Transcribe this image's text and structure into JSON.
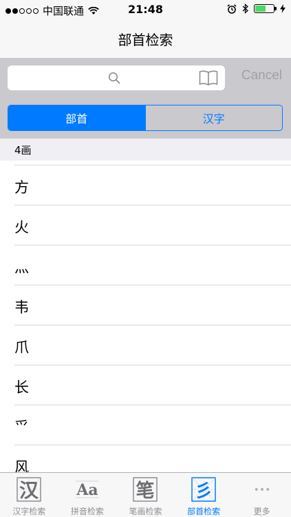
{
  "status_bar": {
    "carrier": "中国联通",
    "time": "21:48"
  },
  "nav": {
    "title": "部首检索"
  },
  "search": {
    "placeholder": "",
    "cancel_label": "Cancel"
  },
  "segments": [
    {
      "label": "部首",
      "selected": true
    },
    {
      "label": "汉字",
      "selected": false
    }
  ],
  "section": {
    "header": "4画"
  },
  "list_items": [
    "方",
    "火",
    "灬",
    "韦",
    "爪",
    "长",
    "爫",
    "风"
  ],
  "tabs": [
    {
      "label": "汉字检索",
      "icon_char": "汉",
      "active": false
    },
    {
      "label": "拼音检索",
      "icon_char": "Aa",
      "active": false
    },
    {
      "label": "笔画检索",
      "icon_char": "笔",
      "active": false
    },
    {
      "label": "部首检索",
      "icon_char": "彡",
      "active": true
    },
    {
      "label": "更多",
      "icon_char": "•••",
      "active": false
    }
  ],
  "colors": {
    "accent": "#007aff",
    "battery": "#4cd964",
    "search_bg": "#c9c9ce",
    "inactive": "#8e8e93"
  }
}
